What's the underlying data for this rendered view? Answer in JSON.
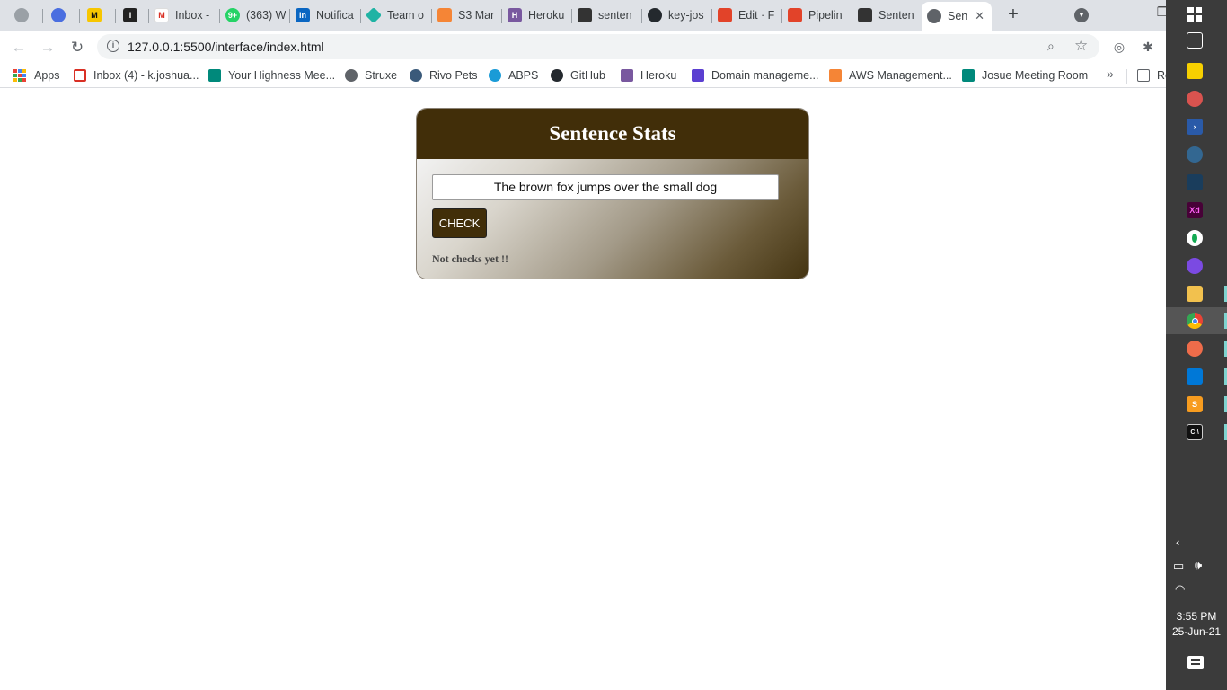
{
  "browser": {
    "tabs": [
      {
        "title": "",
        "icon": "globe-icon",
        "color": "#9aa0a6"
      },
      {
        "title": "",
        "icon": "app-icon",
        "color": "#4a6ee0"
      },
      {
        "title": "",
        "icon": "miro-icon",
        "color": "#f7c600"
      },
      {
        "title": "",
        "icon": "app-icon",
        "color": "#222222"
      },
      {
        "title": "Inbox -",
        "icon": "gmail-icon",
        "color": "#d93025"
      },
      {
        "title": "(363) W",
        "icon": "whatsapp-icon",
        "color": "#25d366"
      },
      {
        "title": "Notifica",
        "icon": "linkedin-icon",
        "color": "#0a66c2"
      },
      {
        "title": "Team o",
        "icon": "diamond-icon",
        "color": "#1fb3a4"
      },
      {
        "title": "S3 Mar",
        "icon": "aws-icon",
        "color": "#f58536"
      },
      {
        "title": "Heroku",
        "icon": "heroku-icon",
        "color": "#79589f"
      },
      {
        "title": "senten",
        "icon": "codesandbox-icon",
        "color": "#333333"
      },
      {
        "title": "key-jos",
        "icon": "github-icon",
        "color": "#24292e"
      },
      {
        "title": "Edit · F",
        "icon": "gitlab-icon",
        "color": "#e24329"
      },
      {
        "title": "Pipelin",
        "icon": "gitlab-icon",
        "color": "#e24329"
      },
      {
        "title": "Senten",
        "icon": "codesandbox-icon",
        "color": "#333333"
      },
      {
        "title": "Sen",
        "icon": "globe-icon",
        "color": "#5f6368"
      }
    ],
    "url": "127.0.0.1:5500/interface/index.html",
    "bookmarks": [
      {
        "label": "Apps",
        "icon": "apps-grid-icon"
      },
      {
        "label": "Inbox (4) - k.joshua...",
        "icon": "gmail-icon",
        "color": "#d93025"
      },
      {
        "label": "Your Highness Mee...",
        "icon": "meet-icon",
        "color": "#00897b"
      },
      {
        "label": "Struxe",
        "icon": "globe-icon",
        "color": "#5f6368"
      },
      {
        "label": "Rivo Pets",
        "icon": "paw-icon",
        "color": "#3a5a7a"
      },
      {
        "label": "ABPS",
        "icon": "react-icon",
        "color": "#1a9bd7"
      },
      {
        "label": "GitHub",
        "icon": "github-icon",
        "color": "#24292e"
      },
      {
        "label": "Heroku",
        "icon": "heroku-icon",
        "color": "#79589f"
      },
      {
        "label": "Domain manageme...",
        "icon": "domain-icon",
        "color": "#5b3fd1"
      },
      {
        "label": "AWS Management...",
        "icon": "aws-icon",
        "color": "#f58536"
      },
      {
        "label": "Josue Meeting Room",
        "icon": "meet-icon",
        "color": "#00897b"
      },
      {
        "label": "Re",
        "icon": "reading-list-icon",
        "color": "#5f6368"
      }
    ]
  },
  "page": {
    "title": "Sentence Stats",
    "input_value": "The brown fox jumps over the small dog",
    "check_label": "CHECK",
    "status": "Not checks yet !!",
    "accent_color": "#412e09"
  },
  "taskbar": {
    "time": "3:55 PM",
    "date": "25-Jun-21"
  }
}
